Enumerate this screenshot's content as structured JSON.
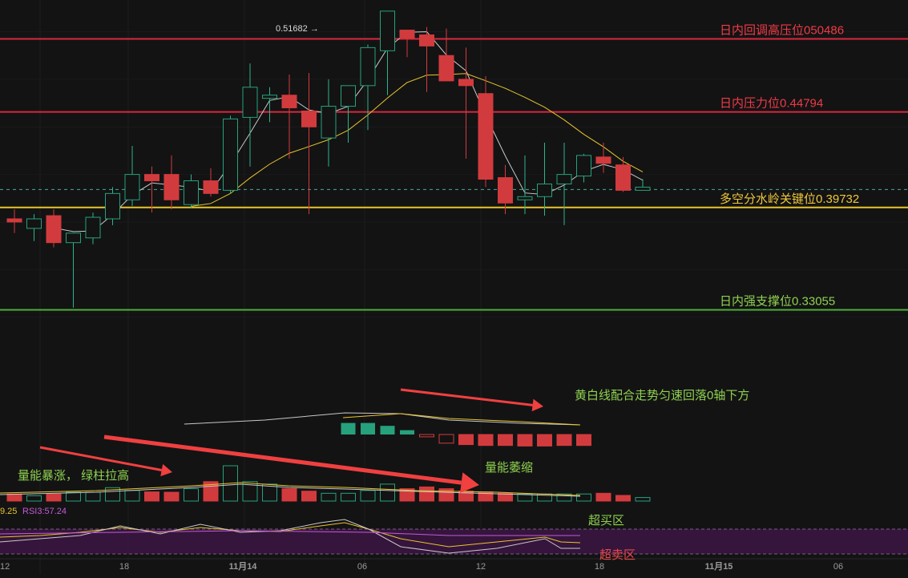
{
  "colors": {
    "background": "#131314",
    "up": "#26a17b",
    "down": "#d23b3d",
    "wick_up": "#2fb38a",
    "ma_white": "#c8c8c8",
    "ma_yellow": "#e8c52c",
    "resistance": "#d8283c",
    "support": "#4caf3a",
    "key_level": "#e8c52c",
    "annotation_green": "#8fd14f",
    "arrow_red": "#f04040",
    "rsi_band": "#3a1640"
  },
  "chart_data": {
    "type": "candlestick",
    "price_axis": {
      "ylim": [
        0.3,
        0.53
      ]
    },
    "peak_label": "0.51682 →",
    "x_ticks": [
      "12",
      "18",
      "11月14",
      "06",
      "12",
      "18",
      "11月15",
      "06"
    ],
    "candles": [
      {
        "o": 0.392,
        "h": 0.398,
        "l": 0.383,
        "c": 0.39
      },
      {
        "o": 0.386,
        "h": 0.395,
        "l": 0.378,
        "c": 0.392
      },
      {
        "o": 0.394,
        "h": 0.398,
        "l": 0.374,
        "c": 0.377
      },
      {
        "o": 0.377,
        "h": 0.382,
        "l": 0.336,
        "c": 0.383
      },
      {
        "o": 0.38,
        "h": 0.396,
        "l": 0.376,
        "c": 0.393
      },
      {
        "o": 0.392,
        "h": 0.412,
        "l": 0.388,
        "c": 0.408
      },
      {
        "o": 0.404,
        "h": 0.438,
        "l": 0.4,
        "c": 0.42
      },
      {
        "o": 0.42,
        "h": 0.425,
        "l": 0.396,
        "c": 0.416
      },
      {
        "o": 0.42,
        "h": 0.432,
        "l": 0.398,
        "c": 0.404
      },
      {
        "o": 0.401,
        "h": 0.42,
        "l": 0.399,
        "c": 0.416
      },
      {
        "o": 0.416,
        "h": 0.424,
        "l": 0.406,
        "c": 0.408
      },
      {
        "o": 0.41,
        "h": 0.457,
        "l": 0.408,
        "c": 0.455
      },
      {
        "o": 0.456,
        "h": 0.49,
        "l": 0.425,
        "c": 0.475
      },
      {
        "o": 0.468,
        "h": 0.475,
        "l": 0.453,
        "c": 0.47
      },
      {
        "o": 0.47,
        "h": 0.483,
        "l": 0.43,
        "c": 0.462
      },
      {
        "o": 0.46,
        "h": 0.484,
        "l": 0.395,
        "c": 0.45
      },
      {
        "o": 0.443,
        "h": 0.48,
        "l": 0.425,
        "c": 0.463
      },
      {
        "o": 0.463,
        "h": 0.475,
        "l": 0.44,
        "c": 0.476
      },
      {
        "o": 0.476,
        "h": 0.502,
        "l": 0.448,
        "c": 0.5
      },
      {
        "o": 0.498,
        "h": 0.517,
        "l": 0.47,
        "c": 0.523
      },
      {
        "o": 0.511,
        "h": 0.511,
        "l": 0.494,
        "c": 0.506
      },
      {
        "o": 0.508,
        "h": 0.513,
        "l": 0.472,
        "c": 0.501
      },
      {
        "o": 0.495,
        "h": 0.512,
        "l": 0.481,
        "c": 0.479
      },
      {
        "o": 0.48,
        "h": 0.5,
        "l": 0.43,
        "c": 0.476
      },
      {
        "o": 0.471,
        "h": 0.482,
        "l": 0.412,
        "c": 0.417
      },
      {
        "o": 0.418,
        "h": 0.426,
        "l": 0.395,
        "c": 0.402
      },
      {
        "o": 0.404,
        "h": 0.432,
        "l": 0.395,
        "c": 0.406
      },
      {
        "o": 0.406,
        "h": 0.44,
        "l": 0.394,
        "c": 0.414
      },
      {
        "o": 0.414,
        "h": 0.44,
        "l": 0.388,
        "c": 0.42
      },
      {
        "o": 0.419,
        "h": 0.433,
        "l": 0.415,
        "c": 0.432
      },
      {
        "o": 0.431,
        "h": 0.44,
        "l": 0.421,
        "c": 0.427
      },
      {
        "o": 0.426,
        "h": 0.431,
        "l": 0.409,
        "c": 0.41
      },
      {
        "o": 0.41,
        "h": 0.417,
        "l": 0.41,
        "c": 0.412
      }
    ],
    "levels": [
      {
        "label": "日内回调高压位050486",
        "value": 0.5055,
        "kind": "resistance"
      },
      {
        "label": "日内压力位0.44794",
        "value": 0.4594,
        "kind": "resistance"
      },
      {
        "label": "多空分水岭关键位0.39732",
        "value": 0.3992,
        "kind": "key_level"
      },
      {
        "label": "日内强支撑位0.33055",
        "value": 0.3346,
        "kind": "support"
      }
    ],
    "current_price": 0.4105,
    "macd": {
      "annotation": "黄白线配合走势匀速回落0轴下方",
      "hist_start_index": 17,
      "hist": [
        0.4,
        0.4,
        0.3,
        0.15,
        -0.08,
        -0.3,
        -0.35,
        -0.38,
        -0.38,
        -0.4,
        -0.4,
        -0.38,
        -0.38
      ]
    },
    "volume": {
      "annotations": [
        "量能暴涨， 绿柱拉高",
        "量能萎缩"
      ],
      "bars": [
        0.2,
        0.15,
        0.2,
        0.25,
        0.25,
        0.38,
        0.3,
        0.26,
        0.25,
        0.35,
        0.55,
        1.0,
        0.55,
        0.48,
        0.35,
        0.28,
        0.22,
        0.22,
        0.3,
        0.48,
        0.35,
        0.4,
        0.35,
        0.28,
        0.26,
        0.22,
        0.2,
        0.2,
        0.2,
        0.2,
        0.22,
        0.16,
        0.1
      ]
    },
    "rsi": {
      "label_value": "9.25",
      "label_rsi": "RSI3:57.24",
      "overbought_label": "超买区",
      "oversold_label": "超卖区"
    }
  }
}
